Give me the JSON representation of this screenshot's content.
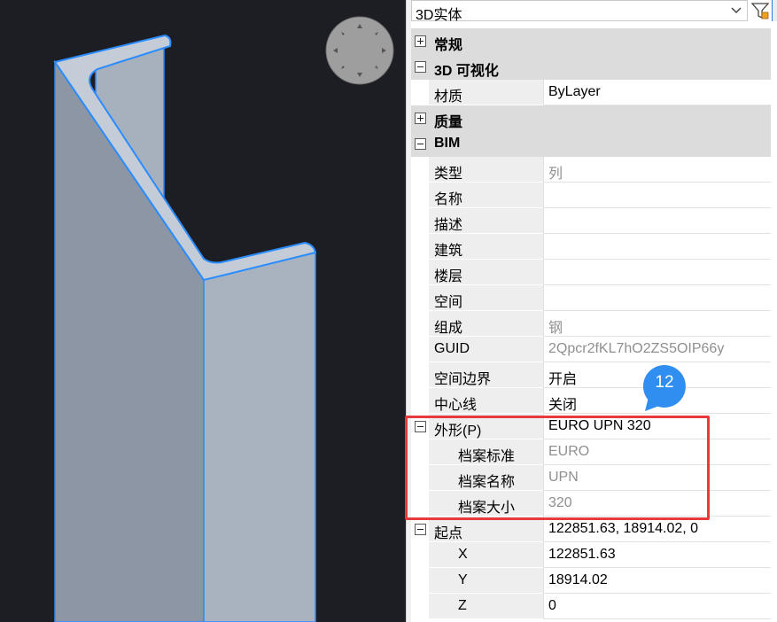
{
  "panel": {
    "selector_value": "3D实体",
    "rows": [
      {
        "kind": "cat",
        "expander": "plus",
        "label": "常规"
      },
      {
        "kind": "cat",
        "expander": "minus",
        "label": "3D 可视化"
      },
      {
        "kind": "prop",
        "name": "材质",
        "value": "ByLayer",
        "value_gray": false
      },
      {
        "kind": "cat",
        "expander": "plus",
        "label": "质量"
      },
      {
        "kind": "cat",
        "expander": "minus",
        "label": "BIM"
      },
      {
        "kind": "prop",
        "name": "类型",
        "value": "列",
        "value_gray": true
      },
      {
        "kind": "prop",
        "name": "名称",
        "value": "",
        "value_gray": false
      },
      {
        "kind": "prop",
        "name": "描述",
        "value": "",
        "value_gray": false
      },
      {
        "kind": "prop",
        "name": "建筑",
        "value": "",
        "value_gray": false
      },
      {
        "kind": "prop",
        "name": "楼层",
        "value": "",
        "value_gray": false
      },
      {
        "kind": "prop",
        "name": "空间",
        "value": "",
        "value_gray": false
      },
      {
        "kind": "prop",
        "name": "组成",
        "value": "钢",
        "value_gray": true
      },
      {
        "kind": "prop",
        "name": "GUID",
        "value": "2Qpcr2fKL7hO2ZS5OIP66y",
        "value_gray": true
      },
      {
        "kind": "prop",
        "name": "空间边界",
        "value": "开启",
        "value_gray": false
      },
      {
        "kind": "prop",
        "name": "中心线",
        "value": "关闭",
        "value_gray": false
      },
      {
        "kind": "group",
        "expander": "minus",
        "name": "外形(P)",
        "value": "EURO UPN 320",
        "value_gray": false
      },
      {
        "kind": "sub",
        "name": "档案标准",
        "value": "EURO",
        "value_gray": true
      },
      {
        "kind": "sub",
        "name": "档案名称",
        "value": "UPN",
        "value_gray": true
      },
      {
        "kind": "sub",
        "name": "档案大小",
        "value": "320",
        "value_gray": true
      },
      {
        "kind": "group",
        "expander": "minus",
        "name": "起点",
        "value": "122851.63, 18914.02, 0",
        "value_gray": false
      },
      {
        "kind": "sub",
        "name": "X",
        "value": "122851.63",
        "value_gray": false
      },
      {
        "kind": "sub",
        "name": "Y",
        "value": "18914.02",
        "value_gray": false
      },
      {
        "kind": "sub",
        "name": "Z",
        "value": "0",
        "value_gray": false
      }
    ]
  },
  "callout": {
    "number": "12"
  },
  "colors": {
    "viewport_bg": "#1d1e23",
    "profile_face": "#b7c0cc",
    "profile_edge": "#2a8cff",
    "highlight_box": "#e8393d",
    "callout": "#2f8ef0",
    "category_bg": "#dcdcdc"
  },
  "icons": [
    "view-navigator-icon",
    "dropdown-arrow-icon",
    "filter-icon",
    "expand-plus-icon",
    "collapse-minus-icon"
  ]
}
